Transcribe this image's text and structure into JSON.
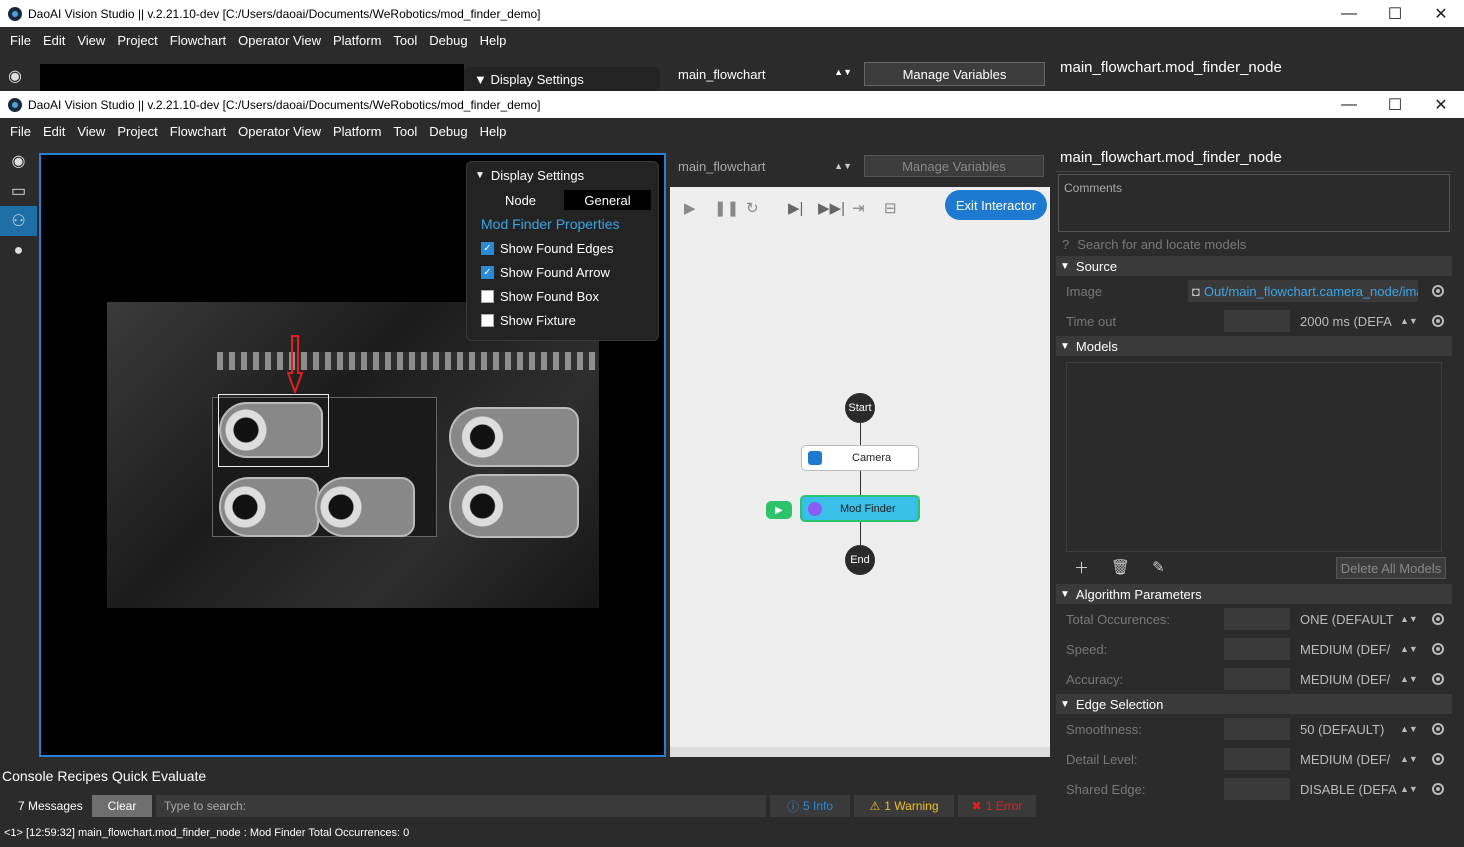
{
  "back_window": {
    "title": "DaoAI Vision Studio || v.2.21.10-dev   [C:/Users/daoai/Documents/WeRobotics/mod_finder_demo]",
    "menu": [
      "File",
      "Edit",
      "View",
      "Project",
      "Flowchart",
      "Operator View",
      "Platform",
      "Tool",
      "Debug",
      "Help"
    ],
    "display_settings": "Display Settings",
    "flowchart_select": "main_flowchart",
    "manage_variables": "Manage Variables",
    "node_title": "main_flowchart.mod_finder_node"
  },
  "window": {
    "title": "DaoAI Vision Studio || v.2.21.10-dev   [C:/Users/daoai/Documents/WeRobotics/mod_finder_demo]",
    "minimize": "—",
    "maximize": "☐",
    "close": "✕"
  },
  "menu": [
    "File",
    "Edit",
    "View",
    "Project",
    "Flowchart",
    "Operator View",
    "Platform",
    "Tool",
    "Debug",
    "Help"
  ],
  "display_settings": {
    "header": "Display Settings",
    "tabs": [
      "Node",
      "General"
    ],
    "section": "Mod Finder Properties",
    "options": [
      {
        "label": "Show Found Edges",
        "checked": true
      },
      {
        "label": "Show Found Arrow",
        "checked": true
      },
      {
        "label": "Show Found Box",
        "checked": false
      },
      {
        "label": "Show Fixture",
        "checked": false
      }
    ]
  },
  "flowchart": {
    "select_value": "main_flowchart",
    "manage_variables": "Manage Variables",
    "exit_interactor": "Exit Interactor",
    "nodes": {
      "start": "Start",
      "camera": "Camera",
      "mod_finder": "Mod Finder",
      "end": "End"
    }
  },
  "properties": {
    "title": "main_flowchart.mod_finder_node",
    "comments_placeholder": "Comments",
    "search_placeholder": "Search for and locate models",
    "source": {
      "header": "Source",
      "image_label": "Image",
      "image_value": "Out/main_flowchart.camera_node/ima",
      "timeout_label": "Time out",
      "timeout_value": "2000 ms (DEFA"
    },
    "models": {
      "header": "Models",
      "delete_all": "Delete All Models"
    },
    "algorithm": {
      "header": "Algorithm Parameters",
      "rows": [
        {
          "label": "Total Occurences:",
          "value": "ONE (DEFAULT"
        },
        {
          "label": "Speed:",
          "value": "MEDIUM (DEF/"
        },
        {
          "label": "Accuracy:",
          "value": "MEDIUM (DEF/"
        }
      ]
    },
    "edge": {
      "header": "Edge Selection",
      "rows": [
        {
          "label": "Smoothness:",
          "value": "50 (DEFAULT)"
        },
        {
          "label": "Detail Level:",
          "value": "MEDIUM (DEF/"
        },
        {
          "label": "Shared Edge:",
          "value": "DISABLE (DEFA"
        }
      ]
    }
  },
  "dock_tabs": [
    "Console",
    "Recipes",
    "Quick Evaluate"
  ],
  "console": {
    "messages": "7 Messages",
    "clear": "Clear",
    "search_placeholder": "Type to search:",
    "info": "5 Info",
    "warning": "1 Warning",
    "error": "1 Error",
    "log_line": "<1> [12:59:32] main_flowchart.mod_finder_node : Mod Finder Total Occurrences: 0"
  },
  "colors": {
    "accent": "#1e7ad0",
    "selected_node": "#39c0e8",
    "run_green": "#2cc36b",
    "link": "#38a6e8"
  }
}
